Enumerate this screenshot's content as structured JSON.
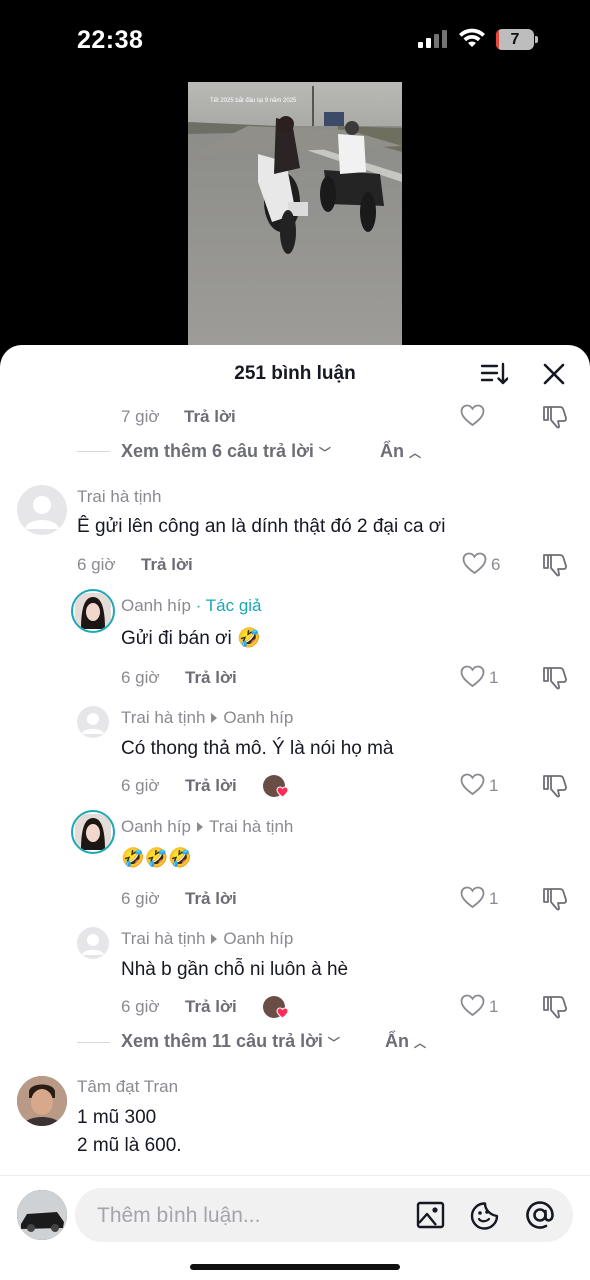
{
  "status_bar": {
    "time": "22:38",
    "battery_level": "7"
  },
  "video": {
    "caption": "Tết 2025 bắt đầu lại 9 năm 2025"
  },
  "sheet": {
    "title": "251 bình luận"
  },
  "thread_top": {
    "time": "7 giờ",
    "reply_label": "Trả lời",
    "more_replies": "Xem thêm 6 câu trả lời",
    "hide_label": "Ẩn"
  },
  "comments": [
    {
      "user": "Trai hà tịnh",
      "text": "Ê gửi lên công an là dính thật đó 2 đại ca ơi",
      "time": "6 giờ",
      "reply_label": "Trả lời",
      "likes": "6"
    },
    {
      "user": "Oanh híp",
      "author_badge": "· Tác giả",
      "text": "Gửi đi bán ơi 🤣",
      "time": "6 giờ",
      "reply_label": "Trả lời",
      "likes": "1"
    },
    {
      "user": "Trai hà tịnh",
      "reply_to": "Oanh híp",
      "text": "Có thong thả mô. Ý là nói họ mà",
      "time": "6 giờ",
      "reply_label": "Trả lời",
      "likes": "1"
    },
    {
      "user": "Oanh híp",
      "reply_to": "Trai hà tịnh",
      "text": "🤣🤣🤣",
      "time": "6 giờ",
      "reply_label": "Trả lời",
      "likes": "1"
    },
    {
      "user": "Trai hà tịnh",
      "reply_to": "Oanh híp",
      "text": "Nhà b gần chỗ ni luôn à hè",
      "time": "6 giờ",
      "reply_label": "Trả lời",
      "likes": "1"
    },
    {
      "user": "Tâm đạt Tran",
      "text_line1": "1 mũ 300",
      "text_line2": "2 mũ là 600."
    }
  ],
  "thread_bottom": {
    "more_replies": "Xem thêm 11 câu trả lời",
    "hide_label": "Ẩn"
  },
  "input": {
    "placeholder": "Thêm bình luận..."
  },
  "colors": {
    "accent": "#1aa7b6",
    "like_heart": "#fe2c55"
  }
}
